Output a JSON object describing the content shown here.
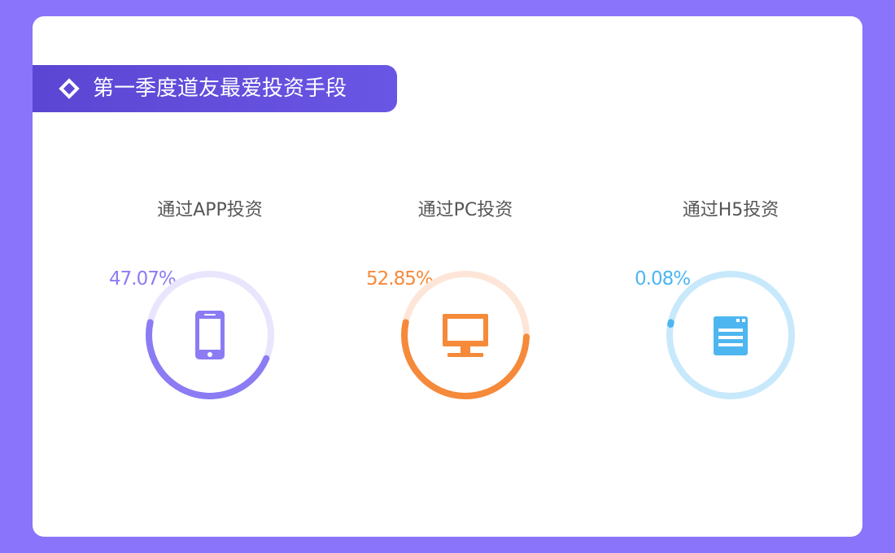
{
  "header": {
    "title": "第一季度道友最爱投资手段",
    "icon": "diamond-icon"
  },
  "items": [
    {
      "label": "通过APP投资",
      "percent_text": "47.07%",
      "percent": 47.07,
      "color": "#8b7cf4",
      "track": "#e8e5fd",
      "icon": "mobile-phone-icon"
    },
    {
      "label": "通过PC投资",
      "percent_text": "52.85%",
      "percent": 52.85,
      "color": "#f58a3a",
      "track": "#fde6d8",
      "icon": "desktop-monitor-icon"
    },
    {
      "label": "通过H5投资",
      "percent_text": "0.08%",
      "percent": 0.08,
      "color": "#4db6f0",
      "track": "#c8e9fb",
      "icon": "web-page-icon"
    }
  ]
}
